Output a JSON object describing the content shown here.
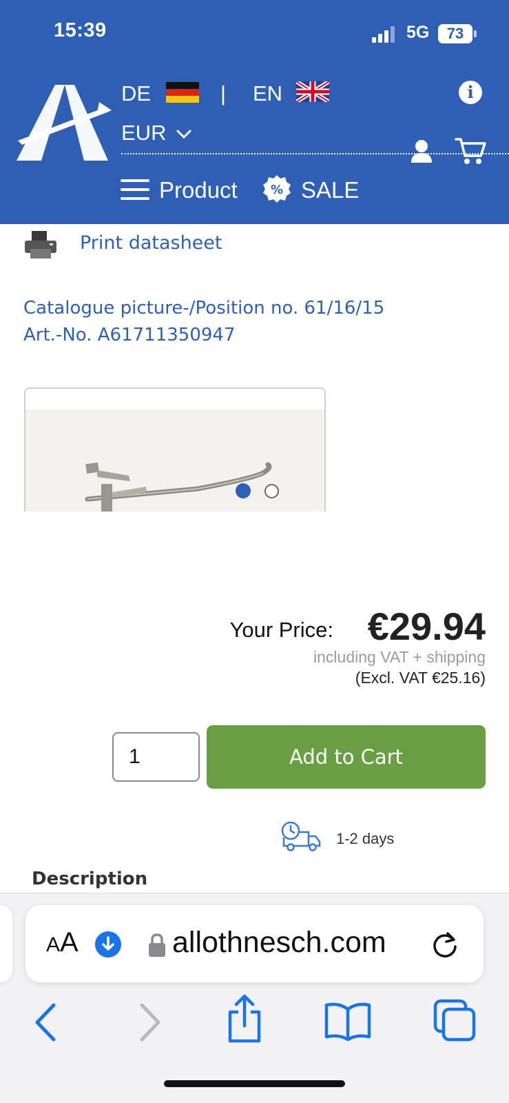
{
  "status_bar": {
    "time": "15:39",
    "network": "5G",
    "battery": "73"
  },
  "header": {
    "lang_de": "DE",
    "separator": "|",
    "lang_en": "EN",
    "currency": "EUR",
    "menu_label": "Product",
    "sale_label": "SALE",
    "icons": [
      "logo",
      "flag-de",
      "flag-uk",
      "info-icon",
      "chevron-down-icon",
      "user-icon",
      "cart-icon",
      "menu-icon",
      "sale-percent-icon"
    ]
  },
  "product": {
    "print_label": "Print datasheet",
    "catalogue_line": "Catalogue picture-/Position no. 61/16/15",
    "article_line": "Art.-No. A61711350947",
    "gallery": {
      "total_images": 2,
      "active_index": 0
    },
    "price_label": "Your Price:",
    "price": "€29.94",
    "vat_note": "including VAT + shipping",
    "excl_vat": "(Excl. VAT €25.16)",
    "quantity": "1",
    "add_to_cart": "Add to Cart",
    "delivery": "1-2 days",
    "description_heading": "Description"
  },
  "browser": {
    "aa_label_small": "A",
    "aa_label_large": "A",
    "url": "allothnesch.com"
  },
  "colors": {
    "brand_blue": "#2e5fb4",
    "cart_green": "#6a9e43",
    "link_blue": "#2e5fb4"
  }
}
